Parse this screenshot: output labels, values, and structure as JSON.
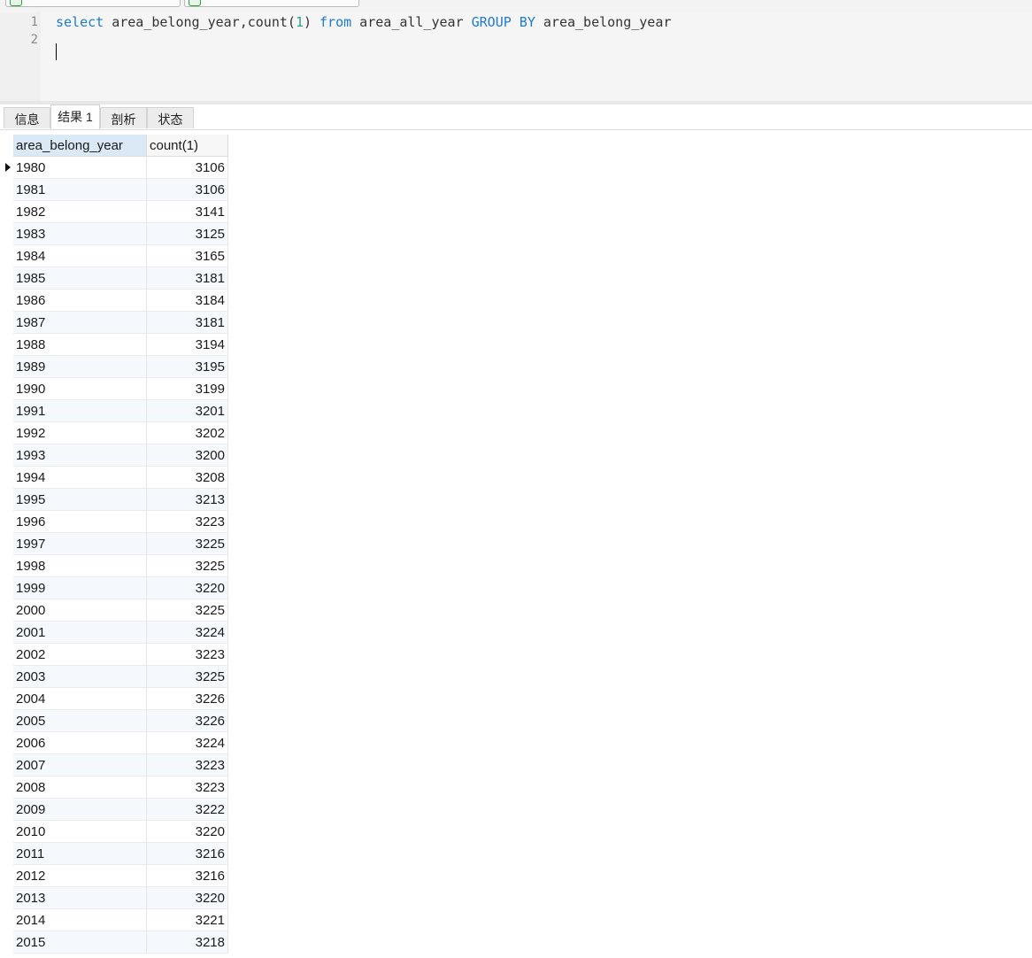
{
  "editor": {
    "line_numbers": [
      "1",
      "2"
    ],
    "query": {
      "kw_select": "select",
      "part1": " area_belong_year,count(",
      "num": "1",
      "part2": ") ",
      "kw_from": "from",
      "part3": " area_all_year ",
      "kw_group": "GROUP BY",
      "part4": " area_belong_year"
    }
  },
  "tabs": [
    {
      "label": "信息",
      "active": false
    },
    {
      "label": "结果 1",
      "active": true
    },
    {
      "label": "剖析",
      "active": false
    },
    {
      "label": "状态",
      "active": false
    }
  ],
  "grid": {
    "columns": [
      "area_belong_year",
      "count(1)"
    ],
    "rows": [
      [
        "1980",
        "3106"
      ],
      [
        "1981",
        "3106"
      ],
      [
        "1982",
        "3141"
      ],
      [
        "1983",
        "3125"
      ],
      [
        "1984",
        "3165"
      ],
      [
        "1985",
        "3181"
      ],
      [
        "1986",
        "3184"
      ],
      [
        "1987",
        "3181"
      ],
      [
        "1988",
        "3194"
      ],
      [
        "1989",
        "3195"
      ],
      [
        "1990",
        "3199"
      ],
      [
        "1991",
        "3201"
      ],
      [
        "1992",
        "3202"
      ],
      [
        "1993",
        "3200"
      ],
      [
        "1994",
        "3208"
      ],
      [
        "1995",
        "3213"
      ],
      [
        "1996",
        "3223"
      ],
      [
        "1997",
        "3225"
      ],
      [
        "1998",
        "3225"
      ],
      [
        "1999",
        "3220"
      ],
      [
        "2000",
        "3225"
      ],
      [
        "2001",
        "3224"
      ],
      [
        "2002",
        "3223"
      ],
      [
        "2003",
        "3225"
      ],
      [
        "2004",
        "3226"
      ],
      [
        "2005",
        "3226"
      ],
      [
        "2006",
        "3224"
      ],
      [
        "2007",
        "3223"
      ],
      [
        "2008",
        "3223"
      ],
      [
        "2009",
        "3222"
      ],
      [
        "2010",
        "3220"
      ],
      [
        "2011",
        "3216"
      ],
      [
        "2012",
        "3216"
      ],
      [
        "2013",
        "3220"
      ],
      [
        "2014",
        "3221"
      ],
      [
        "2015",
        "3218"
      ]
    ]
  }
}
